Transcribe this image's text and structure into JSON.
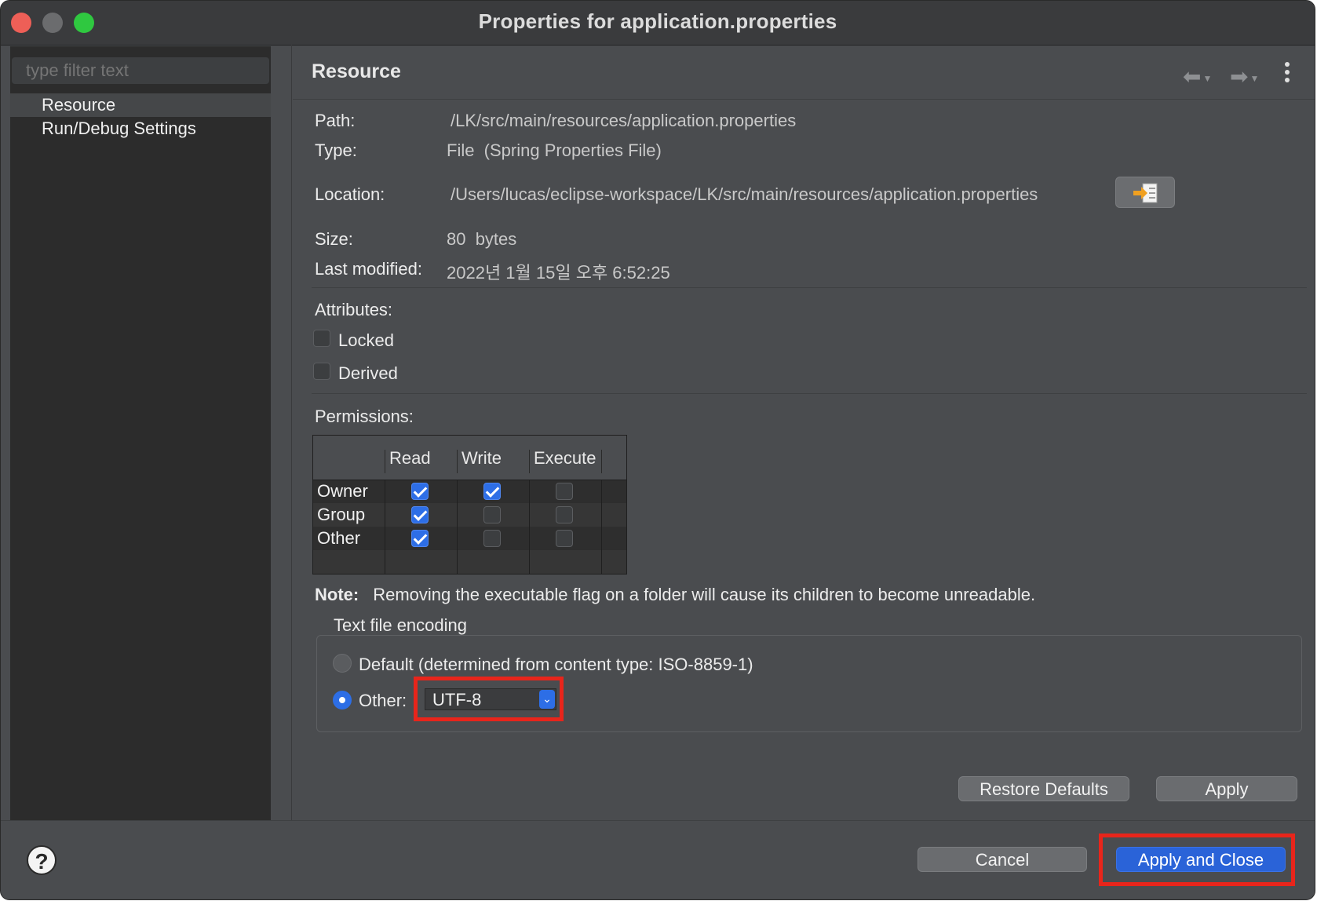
{
  "window": {
    "title": "Properties for application.properties"
  },
  "sidebar": {
    "filter_placeholder": "type filter text",
    "items": [
      {
        "label": "Resource",
        "selected": true
      },
      {
        "label": "Run/Debug Settings",
        "selected": false
      }
    ]
  },
  "page": {
    "title": "Resource",
    "nav": {
      "back_icon": "arrow-left-icon",
      "forward_icon": "arrow-right-icon",
      "menu_icon": "more-vertical-icon"
    }
  },
  "resource": {
    "path_label": "Path:",
    "path_value": "/LK/src/main/resources/application.properties",
    "type_label": "Type:",
    "type_value": "File  (Spring Properties File)",
    "location_label": "Location:",
    "location_value": "/Users/lucas/eclipse-workspace/LK/src/main/resources/application.properties",
    "size_label": "Size:",
    "size_value": "80  bytes",
    "modified_label": "Last modified:",
    "modified_value": "2022년 1월 15일 오후 6:52:25"
  },
  "attributes": {
    "label": "Attributes:",
    "locked_label": "Locked",
    "locked": false,
    "derived_label": "Derived",
    "derived": false
  },
  "permissions": {
    "label": "Permissions:",
    "columns": [
      "Read",
      "Write",
      "Execute"
    ],
    "rows": [
      {
        "label": "Owner",
        "read": true,
        "write": true,
        "execute": false
      },
      {
        "label": "Group",
        "read": true,
        "write": false,
        "execute": false
      },
      {
        "label": "Other",
        "read": true,
        "write": false,
        "execute": false
      }
    ]
  },
  "note": {
    "label": "Note:",
    "text": "Removing the executable flag on a folder will cause its children to become unreadable."
  },
  "encoding": {
    "group_label": "Text file encoding",
    "default_label": "Default (determined from content type: ISO-8859-1)",
    "other_label": "Other:",
    "selected": "other",
    "other_value": "UTF-8"
  },
  "buttons": {
    "restore_defaults": "Restore Defaults",
    "apply": "Apply",
    "cancel": "Cancel",
    "apply_close": "Apply and Close"
  },
  "colors": {
    "accent": "#2d6ee6",
    "highlight": "#e8251b"
  }
}
